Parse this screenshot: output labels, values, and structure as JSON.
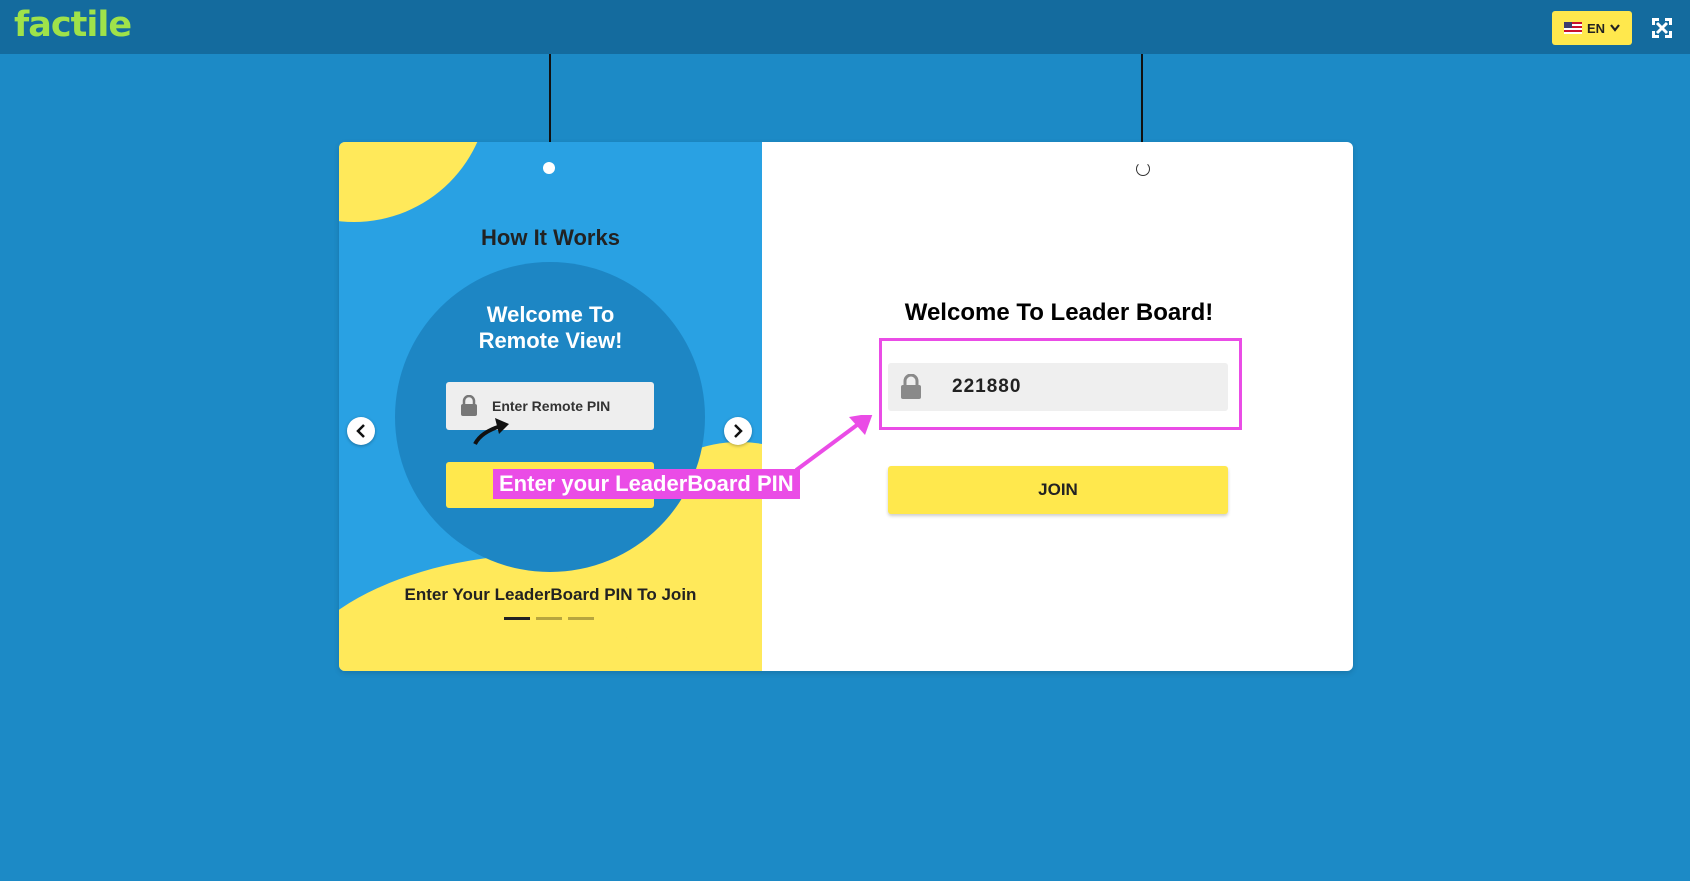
{
  "header": {
    "logo_text": "factile",
    "language_label": "EN",
    "icons": {
      "flag": "us-flag-icon",
      "dropdown": "chevron-down-icon",
      "fullscreen": "fullscreen-icon"
    }
  },
  "how_it_works": {
    "title": "How It Works",
    "slide_heading_line1": "Welcome To",
    "slide_heading_line2": "Remote View!",
    "slide_input_placeholder": "Enter Remote PIN",
    "caption": "Enter Your LeaderBoard PIN To Join",
    "total_slides": 3,
    "active_slide": 1
  },
  "leaderboard": {
    "title": "Welcome To Leader Board!",
    "pin_value": "221880",
    "join_label": "JOIN"
  },
  "annotation": {
    "label": "Enter your LeaderBoard PIN",
    "color": "#ea4ce6"
  },
  "colors": {
    "background": "#1c8ac6",
    "topbar": "#146b9e",
    "logo": "#9fe24a",
    "accent_yellow": "#ffe84d"
  }
}
